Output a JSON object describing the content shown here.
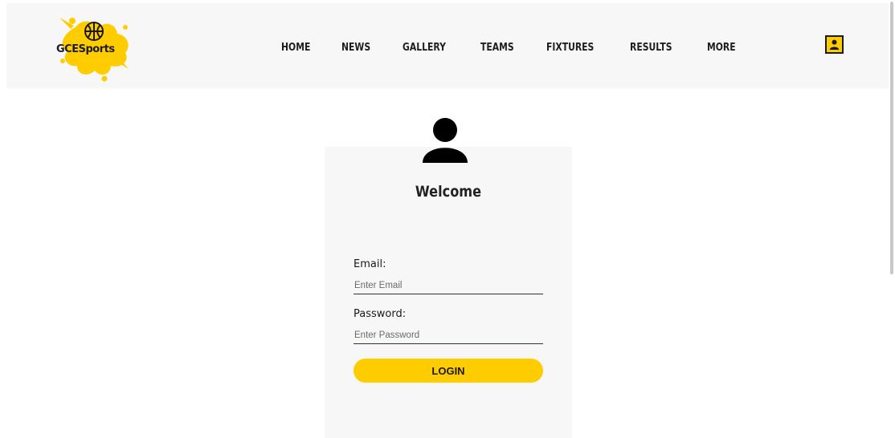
{
  "header": {
    "logo_text": "GCESports",
    "nav_items": [
      "HOME",
      "NEWS",
      "GALLERY",
      "TEAMS",
      "FIXTURES",
      "RESULTS",
      "MORE"
    ],
    "user_icon": "user-icon"
  },
  "login": {
    "avatar_icon": "user-avatar-icon",
    "title": "Welcome",
    "email_label": "Email:",
    "email_placeholder": "Enter Email",
    "email_value": "",
    "password_label": "Password:",
    "password_placeholder": "Enter Password",
    "password_value": "",
    "login_label": "LOGIN"
  },
  "colors": {
    "accent": "#ffcc00",
    "header_bg": "#f7f7f7",
    "text": "#1a1a1a"
  }
}
